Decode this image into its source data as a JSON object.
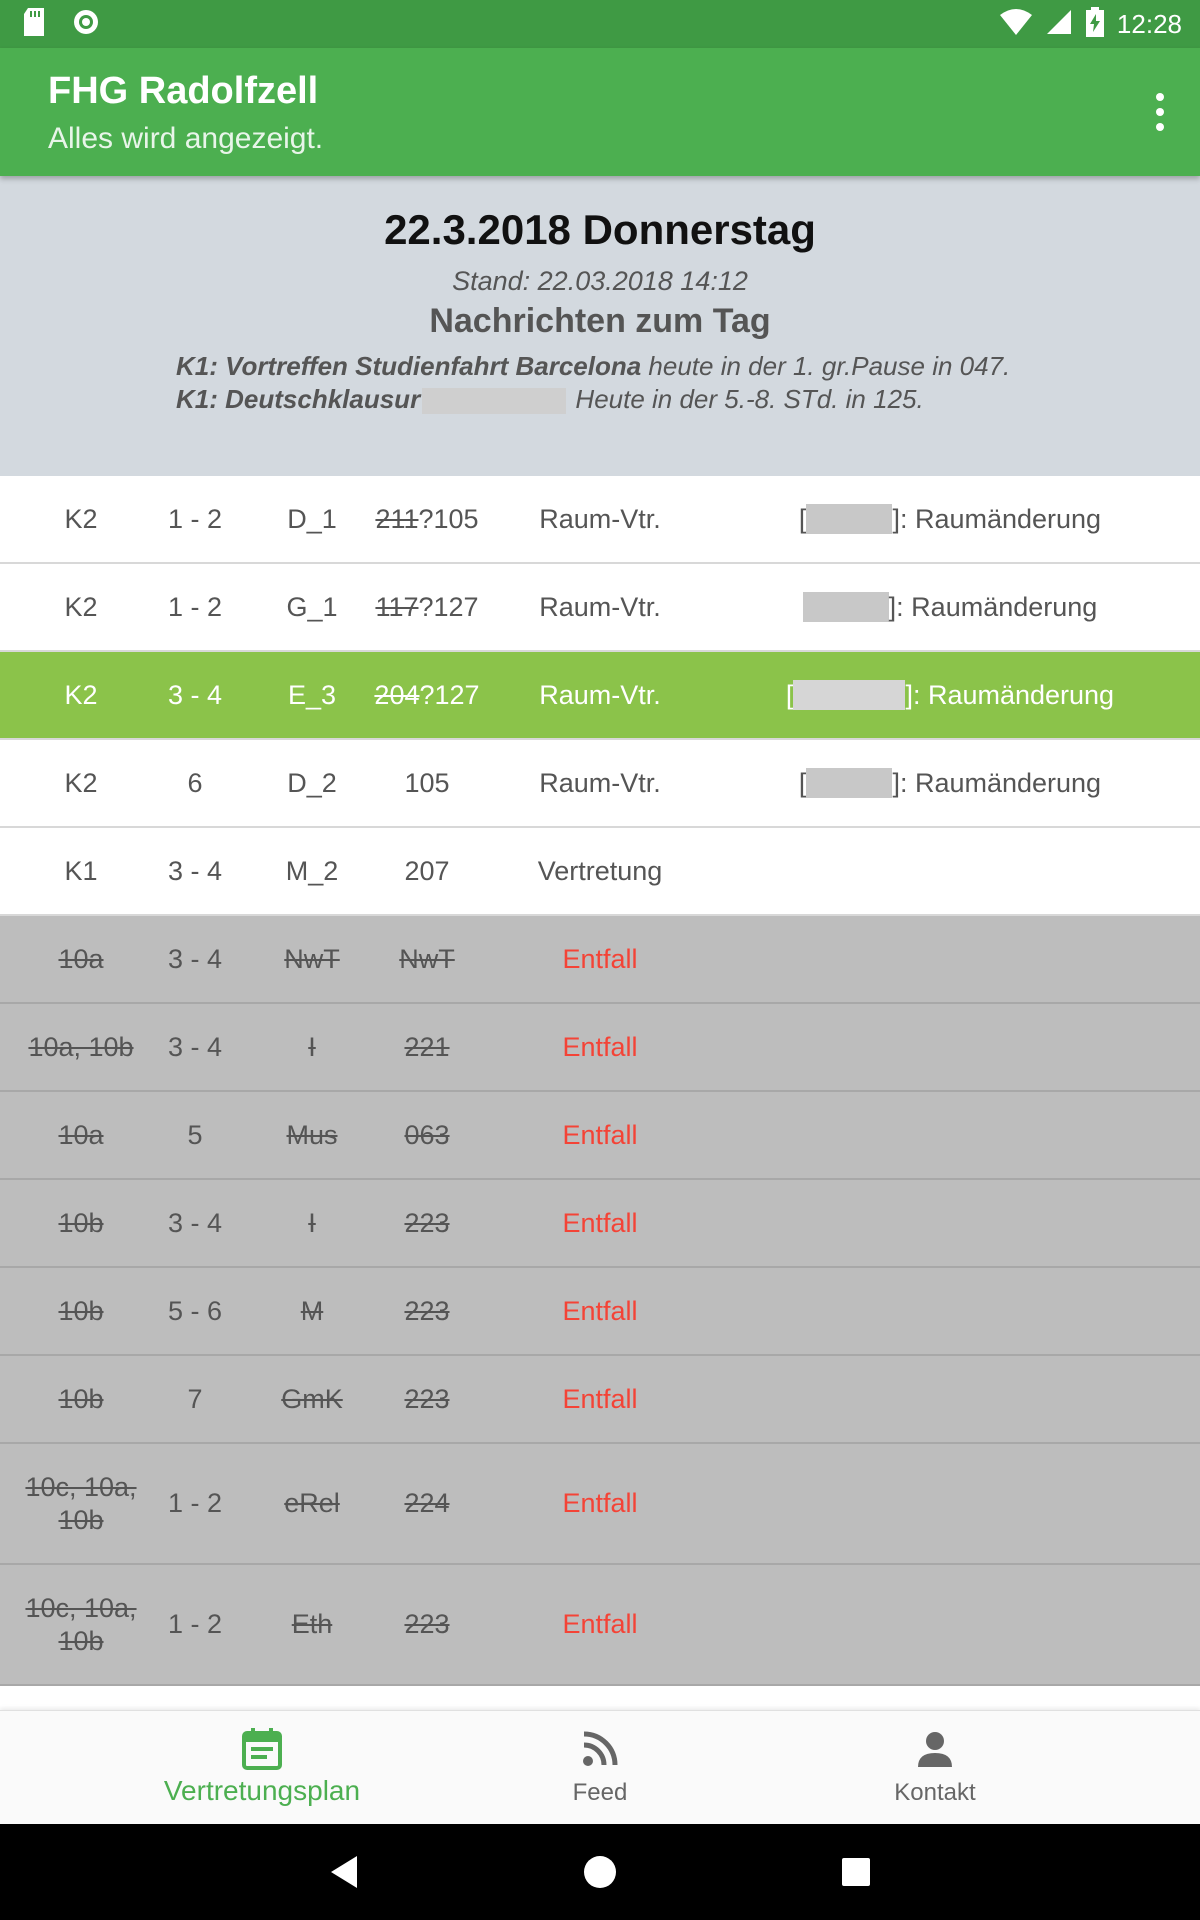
{
  "status_bar": {
    "time": "12:28",
    "icons": [
      "sd-card-icon",
      "sync-icon",
      "wifi-icon",
      "signal-icon",
      "battery-charging-icon"
    ]
  },
  "app_bar": {
    "title": "FHG Radolfzell",
    "subtitle": "Alles wird angezeigt.",
    "menu_icon": "overflow-menu-icon"
  },
  "day": {
    "date": "22.3.2018 Donnerstag",
    "stand": "Stand: 22.03.2018 14:12",
    "news_title": "Nachrichten zum Tag",
    "news": [
      {
        "bold": "K1: Vortreffen Studienfahrt Barcelona",
        "text": " heute in der 1. gr.Pause in 047."
      },
      {
        "bold": "K1: Deutschklausur",
        "text": " Heute in der 5.-8. STd. in 125."
      }
    ]
  },
  "rows": [
    {
      "cls": "K2",
      "hour": "1 - 2",
      "subject": "D_1",
      "room_old": "211",
      "room_new": "?105",
      "type": "Raum-Vtr.",
      "info_pre": "[",
      "info_post": "]: Raumänderung",
      "style": "normal"
    },
    {
      "cls": "K2",
      "hour": "1 - 2",
      "subject": "G_1",
      "room_old": "117",
      "room_new": "?127",
      "type": "Raum-Vtr.",
      "info_pre": "",
      "info_post": "]: Raumänderung",
      "style": "normal"
    },
    {
      "cls": "K2",
      "hour": "3 - 4",
      "subject": "E_3",
      "room_old": "204",
      "room_new": "?127",
      "type": "Raum-Vtr.",
      "info_pre": "[",
      "info_post": "]: Raumänderung",
      "style": "highlight"
    },
    {
      "cls": "K2",
      "hour": "6",
      "subject": "D_2",
      "room_old": "",
      "room_new": "105",
      "type": "Raum-Vtr.",
      "info_pre": "[",
      "info_post": "]: Raumänderung",
      "style": "normal"
    },
    {
      "cls": "K1",
      "hour": "3 - 4",
      "subject": "M_2",
      "room_old": "",
      "room_new": "207",
      "type": "Vertretung",
      "info_pre": "",
      "info_post": "",
      "style": "normal"
    },
    {
      "cls": "10a",
      "hour": "3 - 4",
      "subject": "NwT",
      "room_old": "NwT",
      "room_new": "",
      "type": "Entfall",
      "info_pre": "",
      "info_post": "",
      "style": "cancel"
    },
    {
      "cls": "10a, 10b",
      "hour": "3 - 4",
      "subject": "I",
      "room_old": "221",
      "room_new": "",
      "type": "Entfall",
      "info_pre": "",
      "info_post": "",
      "style": "cancel"
    },
    {
      "cls": "10a",
      "hour": "5",
      "subject": "Mus",
      "room_old": "063",
      "room_new": "",
      "type": "Entfall",
      "info_pre": "",
      "info_post": "",
      "style": "cancel"
    },
    {
      "cls": "10b",
      "hour": "3 - 4",
      "subject": "I",
      "room_old": "223",
      "room_new": "",
      "type": "Entfall",
      "info_pre": "",
      "info_post": "",
      "style": "cancel"
    },
    {
      "cls": "10b",
      "hour": "5 - 6",
      "subject": "M",
      "room_old": "223",
      "room_new": "",
      "type": "Entfall",
      "info_pre": "",
      "info_post": "",
      "style": "cancel"
    },
    {
      "cls": "10b",
      "hour": "7",
      "subject": "GmK",
      "room_old": "223",
      "room_new": "",
      "type": "Entfall",
      "info_pre": "",
      "info_post": "",
      "style": "cancel"
    },
    {
      "cls": "10c, 10a, 10b",
      "hour": "1 - 2",
      "subject": "eRel",
      "room_old": "224",
      "room_new": "",
      "type": "Entfall",
      "info_pre": "",
      "info_post": "",
      "style": "cancel tall"
    },
    {
      "cls": "10c, 10a, 10b",
      "hour": "1 - 2",
      "subject": "Eth",
      "room_old": "223",
      "room_new": "",
      "type": "Entfall",
      "info_pre": "",
      "info_post": "",
      "style": "cancel tall"
    }
  ],
  "bottom_nav": [
    {
      "label": "Vertretungsplan",
      "icon": "calendar-icon",
      "active": true
    },
    {
      "label": "Feed",
      "icon": "rss-feed-icon",
      "active": false
    },
    {
      "label": "Kontakt",
      "icon": "person-icon",
      "active": false
    }
  ],
  "colors": {
    "primary": "#4caf50",
    "status_bar": "#3f9a44",
    "highlight_row": "#8bc34a",
    "cancel_row": "#bdbdbd",
    "entfall_text": "#f44336",
    "header_bg": "#d3d9df"
  }
}
